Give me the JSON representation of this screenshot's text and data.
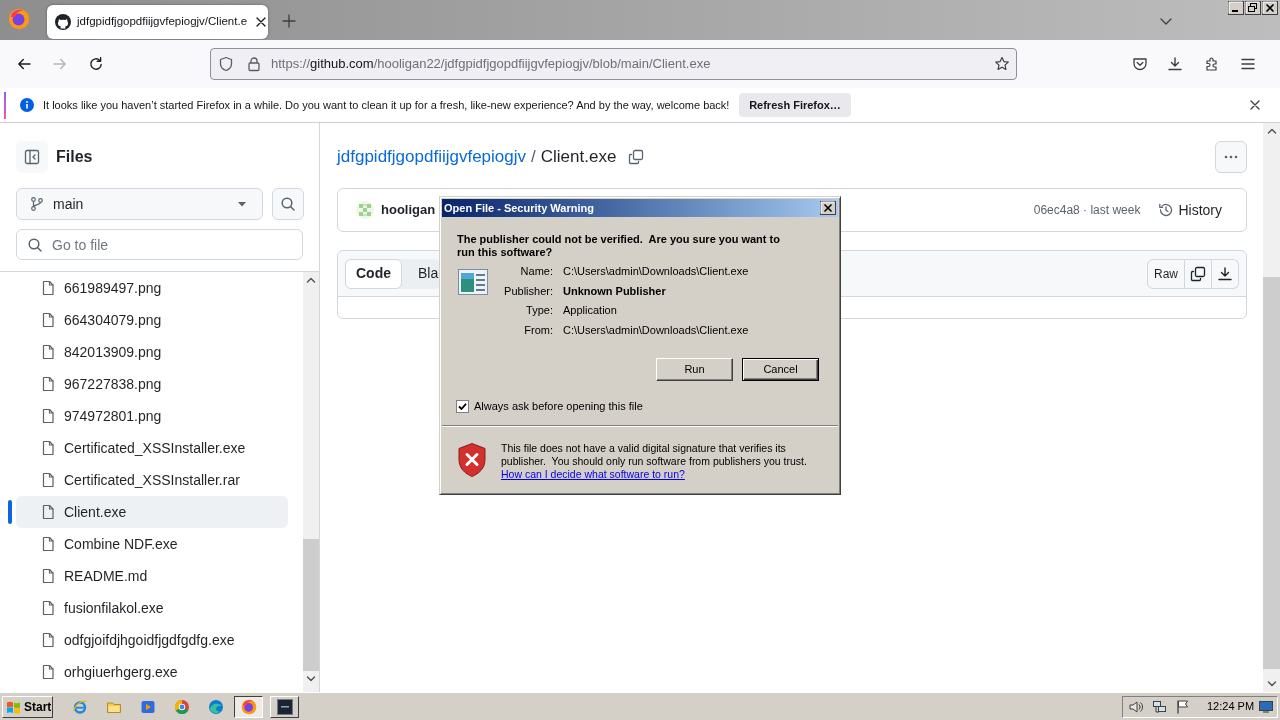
{
  "browser": {
    "tabs": [
      {
        "title": "jdfgpidfjgopdfiijgvfepiogjv/Client.e",
        "selected": true
      }
    ],
    "nav_buttons": [
      {
        "kind": "back",
        "disabled": false
      },
      {
        "kind": "forward",
        "disabled": true
      },
      {
        "kind": "reload",
        "disabled": false
      }
    ],
    "address_bar": {
      "scheme": "https://",
      "host": "github.com",
      "path": "/hooligan22/jdfgpidfjgopdfiijgvfepiogjv/blob/main/Client.exe"
    },
    "notification": {
      "message": "It looks like you haven’t started Firefox in a while. Do you want to clean it up for a fresh, like-new experience? And by the way, welcome back!",
      "button": "Refresh Firefox…"
    }
  },
  "sidebar": {
    "title": "Files",
    "branch": "main",
    "search": {
      "placeholder": "Go to file"
    },
    "files": [
      {
        "name": "661989497.png",
        "selected": false
      },
      {
        "name": "664304079.png",
        "selected": false
      },
      {
        "name": "842013909.png",
        "selected": false
      },
      {
        "name": "967227838.png",
        "selected": false
      },
      {
        "name": "974972801.png",
        "selected": false
      },
      {
        "name": "Certificated_XSSInstaller.exe",
        "selected": false
      },
      {
        "name": "Certificated_XSSInstaller.rar",
        "selected": false
      },
      {
        "name": "Client.exe",
        "selected": true
      },
      {
        "name": "Combine NDF.exe",
        "selected": false
      },
      {
        "name": "README.md",
        "selected": false
      },
      {
        "name": "fusionfilakol.exe",
        "selected": false
      },
      {
        "name": "odfgjoifdjhgoidfjgdfgdfg.exe",
        "selected": false
      },
      {
        "name": "orhgiuerhgerg.exe",
        "selected": false
      }
    ]
  },
  "breadcrumb": {
    "repo": "jdfgpidfjgopdfiijgvfepiogjv",
    "separator": "/",
    "file": "Client.exe"
  },
  "commit": {
    "author": "hooligan",
    "sha_time": "06ec4a8 · last week",
    "history": "History"
  },
  "file_view": {
    "tabs": [
      {
        "label": "Code",
        "selected": true
      },
      {
        "label": "Bla",
        "selected": false
      }
    ],
    "raw": "Raw"
  },
  "dialog": {
    "title": "Open File - Security Warning",
    "heading": "The publisher could not be verified.  Are you sure you want to run this software?",
    "fields": [
      {
        "label": "Name:",
        "value": "C:\\Users\\admin\\Downloads\\Client.exe",
        "emphasized": false
      },
      {
        "label": "Publisher:",
        "value": "Unknown Publisher",
        "emphasized": true
      },
      {
        "label": "Type:",
        "value": "Application",
        "emphasized": false
      },
      {
        "label": "From:",
        "value": "C:\\Users\\admin\\Downloads\\Client.exe",
        "emphasized": false
      }
    ],
    "buttons": [
      {
        "label": "Run",
        "default": false
      },
      {
        "label": "Cancel",
        "default": true
      }
    ],
    "checkbox": {
      "label": "Always ask before opening this file",
      "checked": true
    },
    "warning": "This file does not have a valid digital signature that verifies its publisher.  You should only run software from publishers you trust.",
    "link": "How can I decide what software to run?"
  },
  "taskbar": {
    "start": "Start",
    "windows": [
      {
        "kind": "browser",
        "selected": true
      },
      {
        "kind": "console",
        "selected": false
      }
    ],
    "clock": "12:24 PM"
  }
}
